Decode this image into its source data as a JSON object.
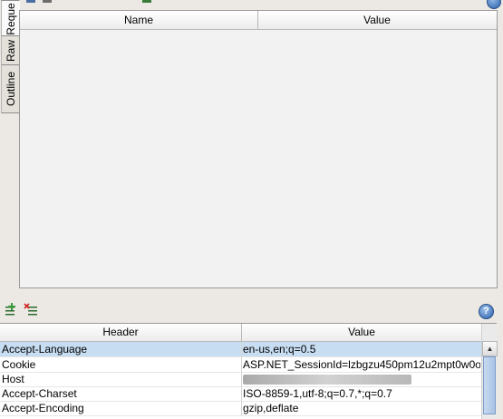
{
  "side_tabs": [
    {
      "label": "Reque",
      "active": true
    },
    {
      "label": "Raw",
      "active": false
    },
    {
      "label": "Outline",
      "active": false
    }
  ],
  "upper_grid": {
    "columns": [
      "Name",
      "Value"
    ]
  },
  "toolbar": {
    "add_icon": "add-header-icon",
    "remove_icon": "remove-header-icon",
    "help_icon": "help-icon",
    "help_glyph": "?"
  },
  "lower_grid": {
    "columns": [
      "Header",
      "Value"
    ],
    "rows": [
      {
        "header": "Accept-Language",
        "value": "en-us,en;q=0.5"
      },
      {
        "header": "Cookie",
        "value": "ASP.NET_SessionId=lzbgzu450pm12u2mpt0w0o..."
      },
      {
        "header": "Host",
        "value": ""
      },
      {
        "header": "Accept-Charset",
        "value": "ISO-8859-1,utf-8;q=0.7,*;q=0.7"
      },
      {
        "header": "Accept-Encoding",
        "value": "gzip,deflate"
      }
    ]
  },
  "colors": {
    "selection": "#c7ddf2",
    "panel": "#f2f2f2",
    "chrome": "#ece9e4"
  }
}
